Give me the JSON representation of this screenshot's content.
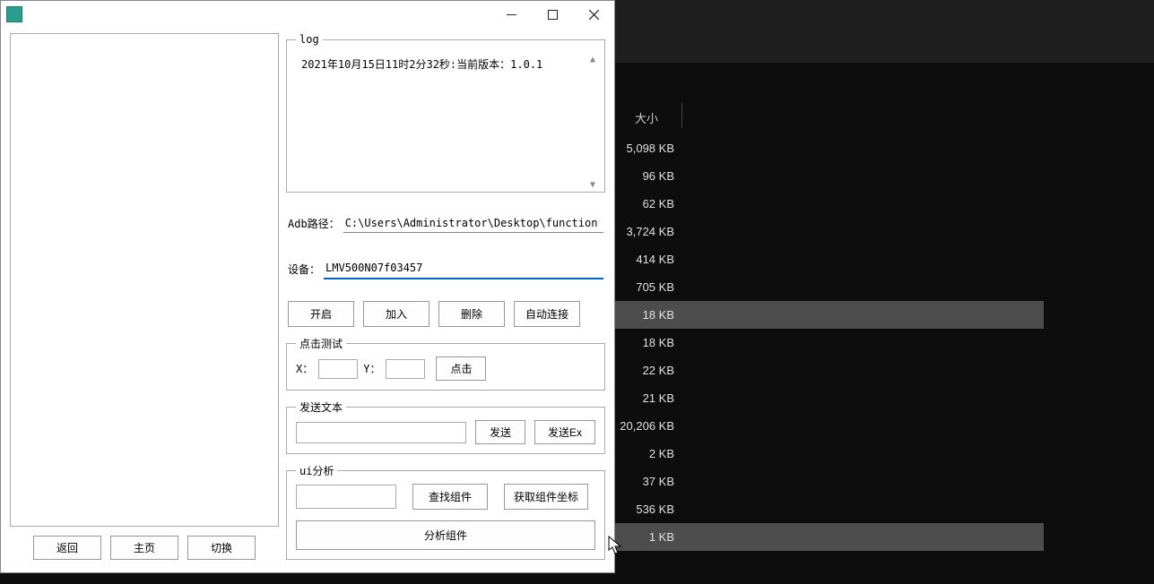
{
  "background": {
    "size_header": "大小",
    "rows": [
      {
        "size": "5,098 KB",
        "selected": false
      },
      {
        "size": "96 KB",
        "selected": false
      },
      {
        "size": "62 KB",
        "selected": false
      },
      {
        "size": "3,724 KB",
        "selected": false
      },
      {
        "size": "414 KB",
        "selected": false
      },
      {
        "size": "705 KB",
        "selected": false
      },
      {
        "size": "18 KB",
        "selected": true
      },
      {
        "size": "18 KB",
        "selected": false
      },
      {
        "size": "22 KB",
        "selected": false
      },
      {
        "size": "21 KB",
        "selected": false
      },
      {
        "size": "20,206 KB",
        "selected": false
      },
      {
        "size": "2 KB",
        "selected": false
      },
      {
        "size": "37 KB",
        "selected": false
      },
      {
        "size": "536 KB",
        "selected": false
      },
      {
        "size": "1 KB",
        "selected": true
      }
    ]
  },
  "dialog": {
    "log": {
      "legend": "log",
      "text": "2021年10月15日11时2分32秒:当前版本：1.0.1"
    },
    "adb_path": {
      "label": "Adb路径：",
      "value": "C:\\Users\\Administrator\\Desktop\\function"
    },
    "device": {
      "label": "设备：",
      "value": "LMV500N07f03457"
    },
    "actions": {
      "open": "开启",
      "add": "加入",
      "delete": "删除",
      "auto_connect": "自动连接"
    },
    "click_test": {
      "legend": "点击测试",
      "x_label": "X：",
      "y_label": "Y：",
      "x_value": "",
      "y_value": "",
      "click_btn": "点击"
    },
    "send_text": {
      "legend": "发送文本",
      "value": "",
      "send": "发送",
      "send_ex": "发送Ex"
    },
    "ui_analysis": {
      "legend": "ui分析",
      "input": "",
      "find_component": "查找组件",
      "get_coords": "获取组件坐标",
      "analyze": "分析组件"
    },
    "left_buttons": {
      "back": "返回",
      "home": "主页",
      "switch": "切换"
    }
  }
}
